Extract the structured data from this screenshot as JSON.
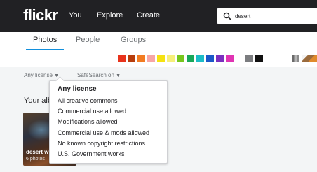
{
  "header": {
    "logo": "flickr",
    "nav": [
      "You",
      "Explore",
      "Create"
    ],
    "search_value": "desert"
  },
  "tabs": [
    "Photos",
    "People",
    "Groups"
  ],
  "color_swatches": [
    "#e8331c",
    "#b83d0d",
    "#f27c22",
    "#f7a6a6",
    "#f5e211",
    "#f6ef7a",
    "#77c61d",
    "#19a85a",
    "#1cbcc7",
    "#1b58c8",
    "#7b2fbf",
    "#e034b3",
    "#ffffff",
    "#7c7d80",
    "#111111"
  ],
  "filters": {
    "license": "Any license",
    "safesearch": "SafeSearch on"
  },
  "section_title": "Your alb",
  "album": {
    "title": "desert w",
    "count": "6 photos"
  },
  "license_menu": {
    "options": [
      "Any license",
      "All creative commons",
      "Commercial use allowed",
      "Modifications allowed",
      "Commercial use & mods allowed",
      "No known copyright restrictions",
      "U.S. Government works"
    ]
  }
}
